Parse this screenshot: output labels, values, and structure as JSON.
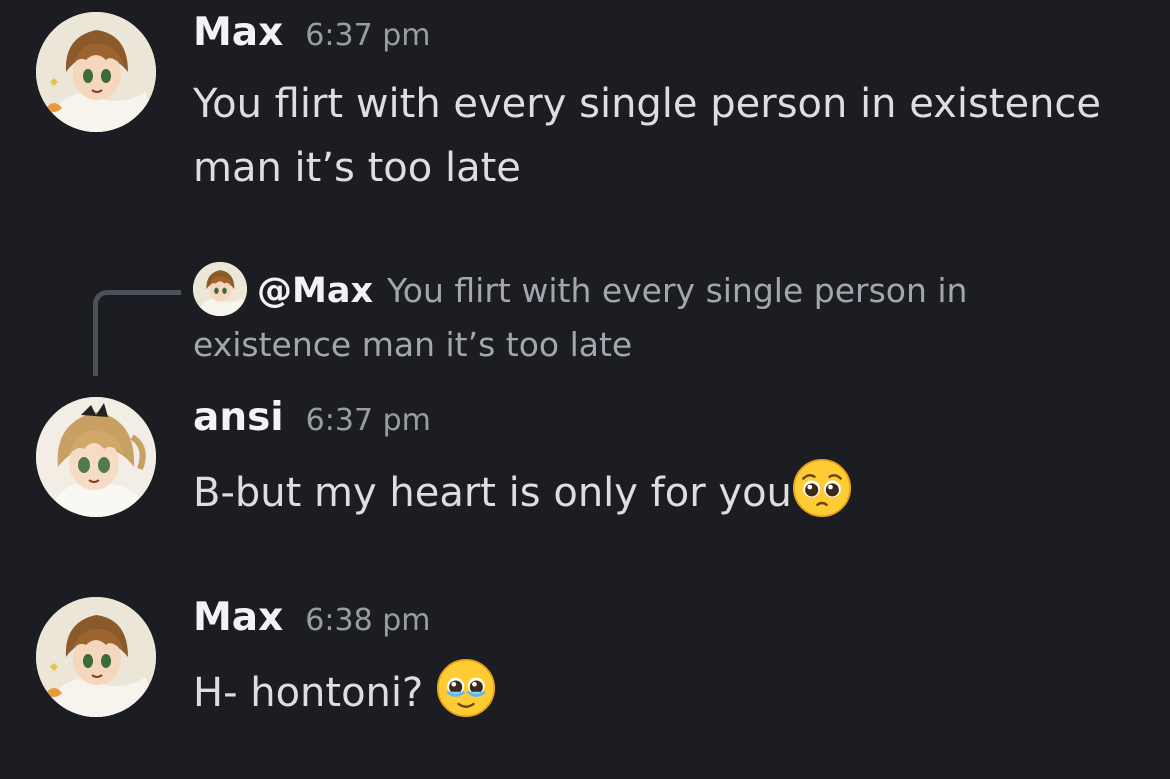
{
  "messages": [
    {
      "author": "Max",
      "time": "6:37 pm",
      "text": "You flirt with every single person in existence man it’s too late",
      "avatar_icon": "anime-boy-avatar"
    },
    {
      "author": "ansi",
      "time": "6:37 pm",
      "text": "B-but my heart is only for you",
      "emoji": "pleading-face-emoji",
      "avatar_icon": "anime-girl-avatar",
      "reply": {
        "author": "@Max",
        "text": "You flirt with every single person in existence man it’s too late"
      }
    },
    {
      "author": "Max",
      "time": "6:38 pm",
      "text": "H- hontoni? ",
      "emoji": "face-holding-back-tears-emoji",
      "avatar_icon": "anime-boy-avatar"
    }
  ],
  "colors": {
    "background": "#1c1d22",
    "username": "#f2f3f5",
    "timestamp": "#9a9ca4",
    "message_text": "#dcdee2",
    "reply_text": "#a3a6ad",
    "reply_line": "#4e5058"
  }
}
